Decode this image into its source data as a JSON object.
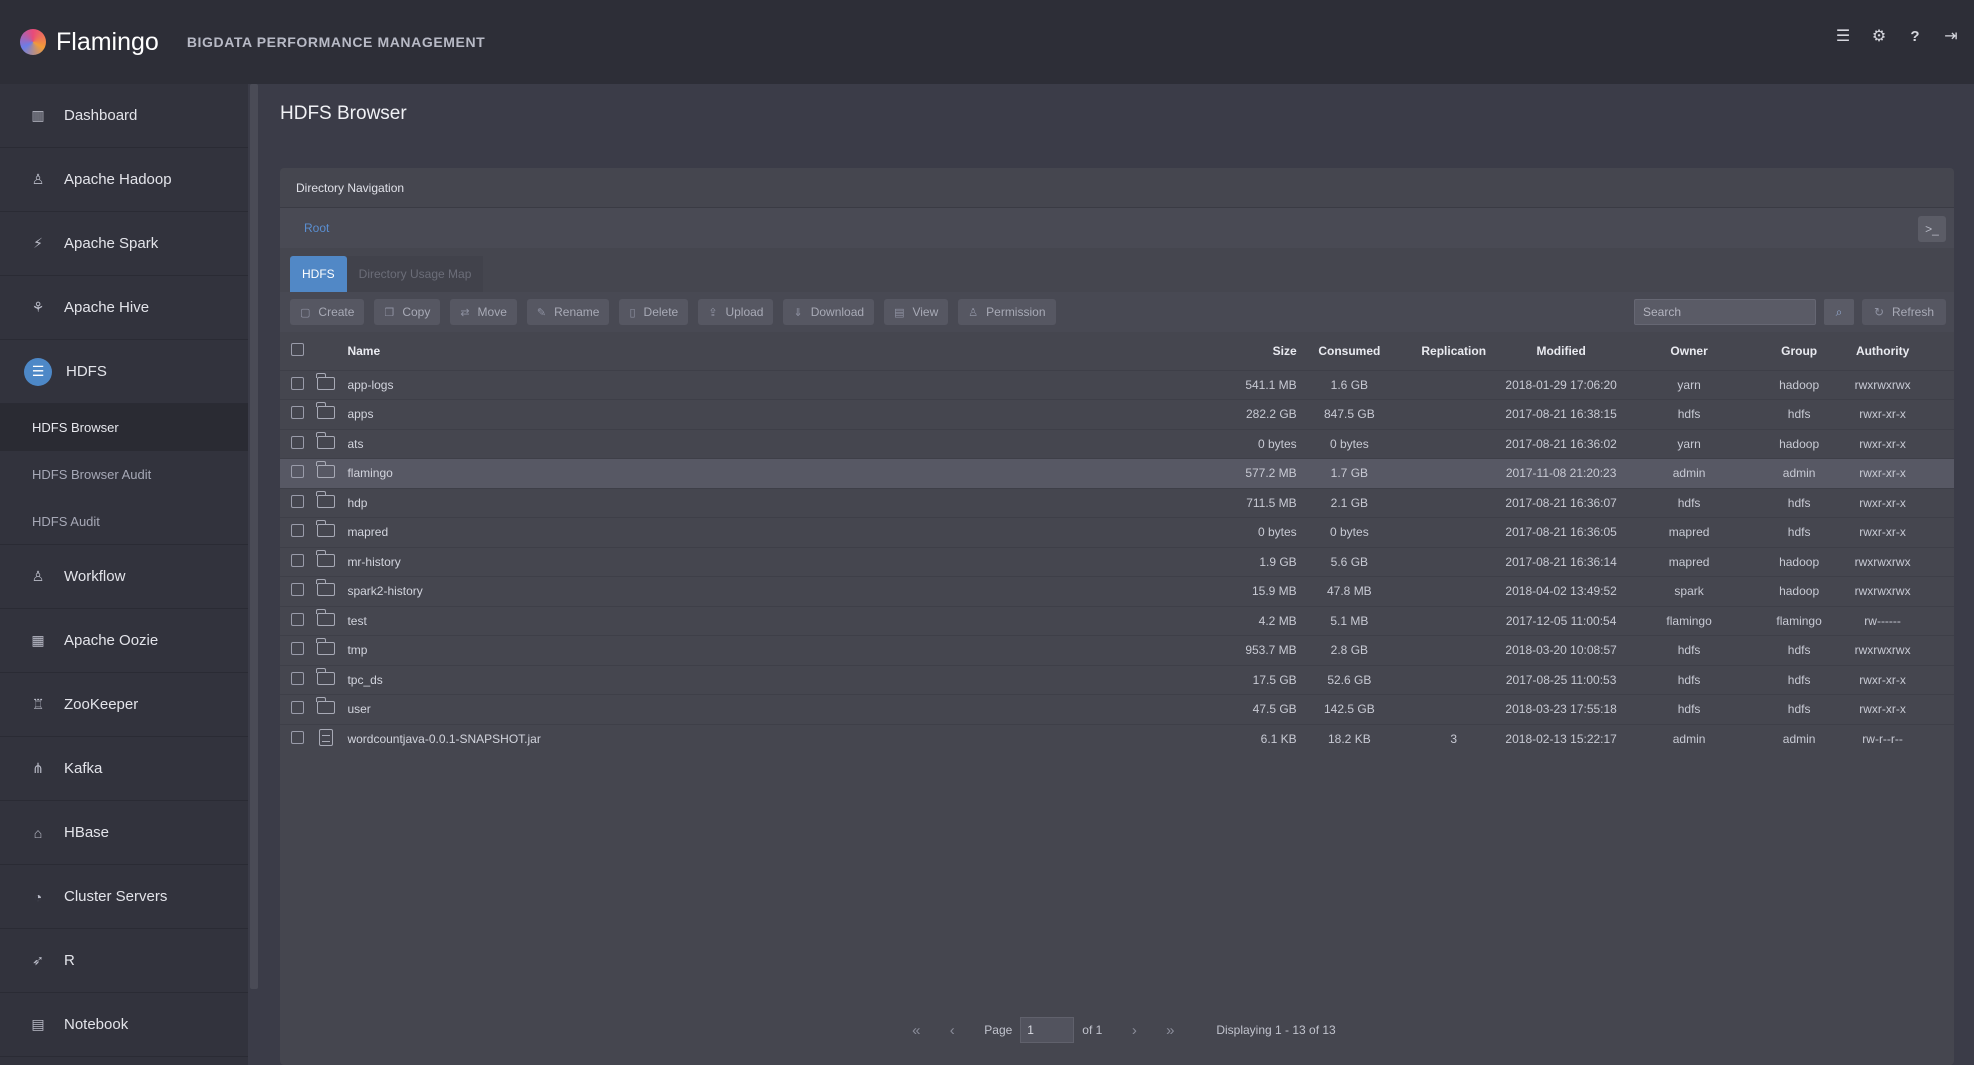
{
  "app": {
    "name": "Flamingo",
    "subtitle": "BIGDATA PERFORMANCE MANAGEMENT",
    "top_icons": [
      "menu-icon",
      "gear-icon",
      "help-icon",
      "logout-icon"
    ]
  },
  "sidebar": {
    "items": [
      {
        "label": "Dashboard",
        "icon": "bar-chart-icon"
      },
      {
        "label": "Apache Hadoop",
        "icon": "sitemap-icon"
      },
      {
        "label": "Apache Spark",
        "icon": "bolt-icon"
      },
      {
        "label": "Apache Hive",
        "icon": "hive-icon"
      },
      {
        "label": "HDFS",
        "icon": "hdfs-icon"
      },
      {
        "label": "Workflow",
        "icon": "sitemap-icon"
      },
      {
        "label": "Apache Oozie",
        "icon": "calendar-icon"
      },
      {
        "label": "ZooKeeper",
        "icon": "zookeeper-icon"
      },
      {
        "label": "Kafka",
        "icon": "kafka-icon"
      },
      {
        "label": "HBase",
        "icon": "hbase-icon"
      },
      {
        "label": "Cluster Servers",
        "icon": "gauge-icon"
      },
      {
        "label": "R",
        "icon": "rocket-icon"
      },
      {
        "label": "Notebook",
        "icon": "notebook-icon"
      }
    ],
    "hdfs_sub": [
      "HDFS Browser",
      "HDFS Browser Audit",
      "HDFS Audit"
    ]
  },
  "page": {
    "title": "HDFS Browser"
  },
  "panel": {
    "header": "Directory Navigation",
    "path": "Root",
    "tabs": [
      "HDFS",
      "Directory Usage Map"
    ]
  },
  "toolbar": {
    "buttons": [
      "Create",
      "Copy",
      "Move",
      "Rename",
      "Delete",
      "Upload",
      "Download",
      "View",
      "Permission"
    ],
    "search_placeholder": "Search",
    "refresh": "Refresh"
  },
  "table": {
    "columns": [
      "Name",
      "Size",
      "Consumed",
      "Replication",
      "Modified",
      "Owner",
      "Group",
      "Authority"
    ],
    "rows": [
      {
        "name": "app-logs",
        "type": "folder",
        "size": "541.1 MB",
        "consumed": "1.6 GB",
        "replication": "",
        "modified": "2018-01-29 17:06:20",
        "owner": "yarn",
        "group": "hadoop",
        "authority": "rwxrwxrwx"
      },
      {
        "name": "apps",
        "type": "folder",
        "size": "282.2 GB",
        "consumed": "847.5 GB",
        "replication": "",
        "modified": "2017-08-21 16:38:15",
        "owner": "hdfs",
        "group": "hdfs",
        "authority": "rwxr-xr-x"
      },
      {
        "name": "ats",
        "type": "folder",
        "size": "0 bytes",
        "consumed": "0 bytes",
        "replication": "",
        "modified": "2017-08-21 16:36:02",
        "owner": "yarn",
        "group": "hadoop",
        "authority": "rwxr-xr-x"
      },
      {
        "name": "flamingo",
        "type": "folder",
        "size": "577.2 MB",
        "consumed": "1.7 GB",
        "replication": "",
        "modified": "2017-11-08 21:20:23",
        "owner": "admin",
        "group": "admin",
        "authority": "rwxr-xr-x"
      },
      {
        "name": "hdp",
        "type": "folder",
        "size": "711.5 MB",
        "consumed": "2.1 GB",
        "replication": "",
        "modified": "2017-08-21 16:36:07",
        "owner": "hdfs",
        "group": "hdfs",
        "authority": "rwxr-xr-x"
      },
      {
        "name": "mapred",
        "type": "folder",
        "size": "0 bytes",
        "consumed": "0 bytes",
        "replication": "",
        "modified": "2017-08-21 16:36:05",
        "owner": "mapred",
        "group": "hdfs",
        "authority": "rwxr-xr-x"
      },
      {
        "name": "mr-history",
        "type": "folder",
        "size": "1.9 GB",
        "consumed": "5.6 GB",
        "replication": "",
        "modified": "2017-08-21 16:36:14",
        "owner": "mapred",
        "group": "hadoop",
        "authority": "rwxrwxrwx"
      },
      {
        "name": "spark2-history",
        "type": "folder",
        "size": "15.9 MB",
        "consumed": "47.8 MB",
        "replication": "",
        "modified": "2018-04-02 13:49:52",
        "owner": "spark",
        "group": "hadoop",
        "authority": "rwxrwxrwx"
      },
      {
        "name": "test",
        "type": "folder",
        "size": "4.2 MB",
        "consumed": "5.1 MB",
        "replication": "",
        "modified": "2017-12-05 11:00:54",
        "owner": "flamingo",
        "group": "flamingo",
        "authority": "rw------"
      },
      {
        "name": "tmp",
        "type": "folder",
        "size": "953.7 MB",
        "consumed": "2.8 GB",
        "replication": "",
        "modified": "2018-03-20 10:08:57",
        "owner": "hdfs",
        "group": "hdfs",
        "authority": "rwxrwxrwx"
      },
      {
        "name": "tpc_ds",
        "type": "folder",
        "size": "17.5 GB",
        "consumed": "52.6 GB",
        "replication": "",
        "modified": "2017-08-25 11:00:53",
        "owner": "hdfs",
        "group": "hdfs",
        "authority": "rwxr-xr-x"
      },
      {
        "name": "user",
        "type": "folder",
        "size": "47.5 GB",
        "consumed": "142.5 GB",
        "replication": "",
        "modified": "2018-03-23 17:55:18",
        "owner": "hdfs",
        "group": "hdfs",
        "authority": "rwxr-xr-x"
      },
      {
        "name": "wordcountjava-0.0.1-SNAPSHOT.jar",
        "type": "file",
        "size": "6.1 KB",
        "consumed": "18.2 KB",
        "replication": "3",
        "modified": "2018-02-13 15:22:17",
        "owner": "admin",
        "group": "admin",
        "authority": "rw-r--r--"
      }
    ],
    "selected_row": "flamingo"
  },
  "pager": {
    "page_label": "Page",
    "page_value": "1",
    "of_label": "of 1",
    "display": "Displaying 1 - 13 of 13"
  }
}
